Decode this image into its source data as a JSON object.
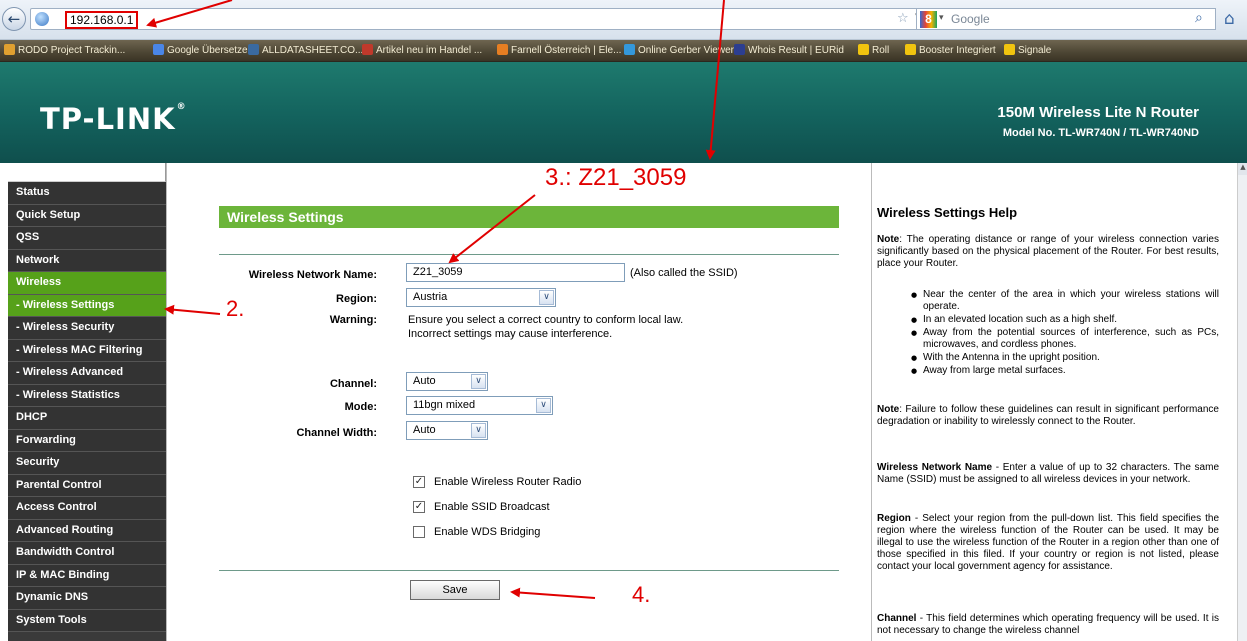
{
  "browser": {
    "back_glyph": "←",
    "url": "192.168.0.1",
    "star_glyph": "☆",
    "dropdown_glyph": "▽",
    "reload_glyph": "C",
    "search_placeholder": "Google",
    "search_engine_letter": "8",
    "search_dropdown_glyph": "▾",
    "search_glyph": "⌕",
    "home_glyph": "⌂"
  },
  "bookmarks": [
    {
      "label": "RODO Project Trackin...",
      "icon_color": "#e0a030"
    },
    {
      "label": "Google Übersetzer",
      "icon_color": "#4a86e8"
    },
    {
      "label": "ALLDATASHEET.CO...",
      "icon_color": "#3a6aa0"
    },
    {
      "label": "Artikel neu im Handel ...",
      "icon_color": "#c0392b"
    },
    {
      "label": "Farnell Österreich | Ele...",
      "icon_color": "#e67e22"
    },
    {
      "label": "Online Gerber Viewer",
      "icon_color": "#3498db"
    },
    {
      "label": "Whois Result | EURid",
      "icon_color": "#2c3e90"
    },
    {
      "label": "Roll",
      "icon_color": "#f1c40f"
    },
    {
      "label": "Booster Integriert",
      "icon_color": "#f1c40f"
    },
    {
      "label": "Signale",
      "icon_color": "#f1c40f"
    }
  ],
  "header": {
    "logo": "TP-LINK",
    "logo_mark": "®",
    "product": "150M Wireless Lite N Router",
    "model": "Model No. TL-WR740N / TL-WR740ND"
  },
  "menu": [
    {
      "label": "Status",
      "state": "normal"
    },
    {
      "label": "Quick Setup",
      "state": "normal"
    },
    {
      "label": "QSS",
      "state": "normal"
    },
    {
      "label": "Network",
      "state": "normal"
    },
    {
      "label": "Wireless",
      "state": "active"
    },
    {
      "label": "- Wireless Settings",
      "state": "selected"
    },
    {
      "label": "- Wireless Security",
      "state": "sub"
    },
    {
      "label": "- Wireless MAC Filtering",
      "state": "sub"
    },
    {
      "label": "- Wireless Advanced",
      "state": "sub"
    },
    {
      "label": "- Wireless Statistics",
      "state": "sub"
    },
    {
      "label": "DHCP",
      "state": "normal"
    },
    {
      "label": "Forwarding",
      "state": "normal"
    },
    {
      "label": "Security",
      "state": "normal"
    },
    {
      "label": "Parental Control",
      "state": "normal"
    },
    {
      "label": "Access Control",
      "state": "normal"
    },
    {
      "label": "Advanced Routing",
      "state": "normal"
    },
    {
      "label": "Bandwidth Control",
      "state": "normal"
    },
    {
      "label": "IP & MAC Binding",
      "state": "normal"
    },
    {
      "label": "Dynamic DNS",
      "state": "normal"
    },
    {
      "label": "System Tools",
      "state": "normal"
    }
  ],
  "form": {
    "title": "Wireless Settings",
    "ssid_label": "Wireless Network Name:",
    "ssid_value": "Z21_3059",
    "ssid_hint": "(Also called the SSID)",
    "region_label": "Region:",
    "region_value": "Austria",
    "warning_label": "Warning:",
    "warning_line1": "Ensure you select a correct country to conform local law.",
    "warning_line2": "Incorrect settings may cause interference.",
    "channel_label": "Channel:",
    "channel_value": "Auto",
    "mode_label": "Mode:",
    "mode_value": "11bgn mixed",
    "width_label": "Channel Width:",
    "width_value": "Auto",
    "select_arrow": "∨",
    "check_glyph": "✓",
    "checkboxes": [
      {
        "label": "Enable Wireless Router Radio",
        "checked": true
      },
      {
        "label": "Enable SSID Broadcast",
        "checked": true
      },
      {
        "label": "Enable WDS Bridging",
        "checked": false
      }
    ],
    "save_label": "Save"
  },
  "help": {
    "title": "Wireless Settings Help",
    "note1_head": "Note",
    "note1": ": The operating distance or range of your wireless connection varies significantly based on the physical placement of the Router. For best results, place your Router.",
    "bullets": [
      "Near the center of the area in which your wireless stations will operate.",
      "In an elevated location such as a high shelf.",
      "Away from the potential sources of interference, such as PCs, microwaves, and cordless phones.",
      "With the Antenna in the upright position.",
      "Away from large metal surfaces."
    ],
    "note2_head": "Note",
    "note2": ": Failure to follow these guidelines can result in significant performance degradation or inability to wirelessly connect to the Router.",
    "ssid_head": "Wireless Network Name",
    "ssid_text": " - Enter a value of up to 32 characters. The same Name (SSID) must be assigned to all wireless devices in your network.",
    "region_head": "Region",
    "region_text": " - Select your region from the pull-down list. This field specifies the region where the wireless function of the Router can be used. It may be illegal to use the wireless function of the Router in a region other than one of those specified in this filed. If your country or region is not listed, please contact your local government agency for assistance.",
    "channel_head": "Channel",
    "channel_text": " - This field determines which operating frequency will be used. It is not necessary to change the wireless channel",
    "scroll_up_glyph": "▲"
  },
  "annotations": {
    "step2": "2.",
    "step3": "3.:  Z21_3059",
    "step4": "4.",
    "color": "#e00000"
  }
}
